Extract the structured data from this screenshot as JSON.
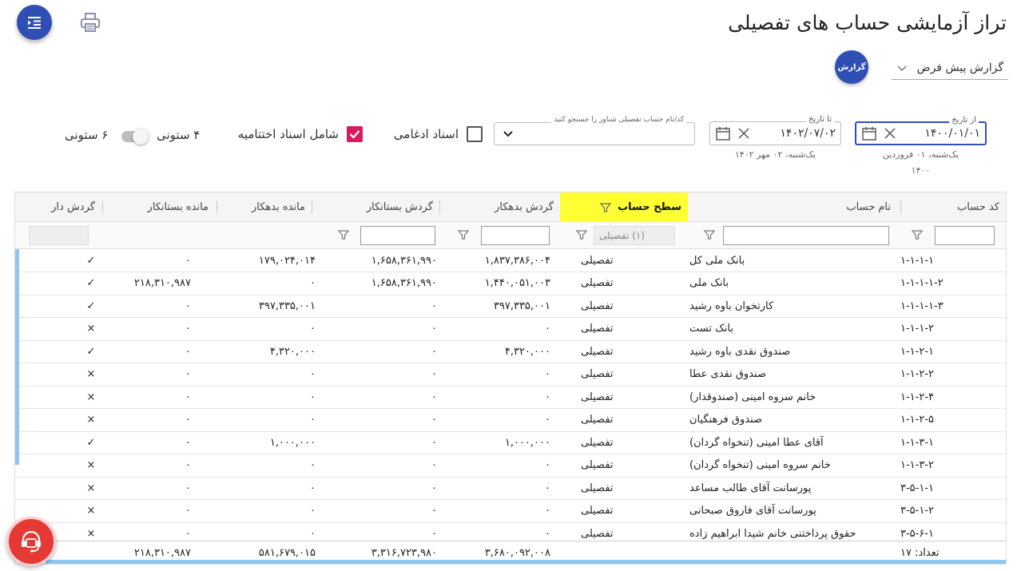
{
  "page": {
    "title": "تراز آزمایشی حساب های تفصیلی"
  },
  "toolbar": {
    "menu_icon": "menu-indent-icon",
    "print_icon": "printer-icon"
  },
  "report": {
    "selected": "گزارش پیش فرض",
    "button_label": "گزارش"
  },
  "filters": {
    "from_date": {
      "label": "از تاریخ",
      "value": "۱۴۰۰/۰۱/۰۱",
      "hint_line1": "یک‌شنبه، ۰۱ فروردین",
      "hint_line2": "۱۴۰۰"
    },
    "to_date": {
      "label": "تا تاریخ",
      "value": "۱۴۰۲/۰۷/۰۲",
      "hint": "یک‌شنبه، ۰۲ مهر ۱۴۰۲"
    },
    "search_label": "کد/نام حساب تفصیلی شناور را جستجو کنید",
    "merged_docs": {
      "label": "اسناد ادغامی",
      "checked": false
    },
    "closing_docs": {
      "label": "شامل اسناد اختتامیه",
      "checked": true
    },
    "cols4_label": "۴ ستونی",
    "cols6_label": "۶ ستونی"
  },
  "grid": {
    "headers": {
      "code": "کد حساب",
      "name": "نام حساب",
      "level": "سطح حساب",
      "debit_turnover": "گردش بدهکار",
      "credit_turnover": "گردش بستانکار",
      "debit_balance": "مانده بدهکار",
      "credit_balance": "مانده بستانکار",
      "has_turnover": "گردش دار"
    },
    "level_filter_value": "(۱) تفصیلی",
    "rows": [
      {
        "code": "۱-۱-۱-۱",
        "name": "بانک ملی کل",
        "level": "تفصیلی",
        "dt": "۱,۸۳۷,۳۸۶,۰۰۴",
        "ct": "۱,۶۵۸,۳۶۱,۹۹۰",
        "db": "۱۷۹,۰۲۴,۰۱۴",
        "cb": "۰",
        "flag": "✓"
      },
      {
        "code": "۱-۱-۱-۱-۲",
        "name": "بانک ملی",
        "level": "تفصیلی",
        "dt": "۱,۴۴۰,۰۵۱,۰۰۳",
        "ct": "۱,۶۵۸,۳۶۱,۹۹۰",
        "db": "۰",
        "cb": "۲۱۸,۳۱۰,۹۸۷",
        "flag": "✓"
      },
      {
        "code": "۱-۱-۱-۱-۳",
        "name": "کارتخوان باوه رشید",
        "level": "تفصیلی",
        "dt": "۳۹۷,۳۳۵,۰۰۱",
        "ct": "۰",
        "db": "۳۹۷,۳۳۵,۰۰۱",
        "cb": "۰",
        "flag": "✓"
      },
      {
        "code": "۱-۱-۱-۲",
        "name": "بانک تست",
        "level": "تفصیلی",
        "dt": "۰",
        "ct": "۰",
        "db": "۰",
        "cb": "۰",
        "flag": "×"
      },
      {
        "code": "۱-۱-۲-۱",
        "name": "صندوق نقدی باوه رشید",
        "level": "تفصیلی",
        "dt": "۴,۳۲۰,۰۰۰",
        "ct": "۰",
        "db": "۴,۳۲۰,۰۰۰",
        "cb": "۰",
        "flag": "✓"
      },
      {
        "code": "۱-۱-۲-۲",
        "name": "صندوق نقدی عطا",
        "level": "تفصیلی",
        "dt": "۰",
        "ct": "۰",
        "db": "۰",
        "cb": "۰",
        "flag": "×"
      },
      {
        "code": "۱-۱-۲-۴",
        "name": "خانم سروه امینی (صندوقدار)",
        "level": "تفصیلی",
        "dt": "۰",
        "ct": "۰",
        "db": "۰",
        "cb": "۰",
        "flag": "×"
      },
      {
        "code": "۱-۱-۲-۵",
        "name": "صندوق فرهنگیان",
        "level": "تفصیلی",
        "dt": "۰",
        "ct": "۰",
        "db": "۰",
        "cb": "۰",
        "flag": "×"
      },
      {
        "code": "۱-۱-۳-۱",
        "name": "آقای عطا امینی (تنخواه گردان)",
        "level": "تفصیلی",
        "dt": "۱,۰۰۰,۰۰۰",
        "ct": "۰",
        "db": "۱,۰۰۰,۰۰۰",
        "cb": "۰",
        "flag": "✓"
      },
      {
        "code": "۱-۱-۳-۲",
        "name": "خانم سروه امینی (تنخواه گردان)",
        "level": "تفصیلی",
        "dt": "۰",
        "ct": "۰",
        "db": "۰",
        "cb": "۰",
        "flag": "×"
      },
      {
        "code": "۳-۵-۱-۱",
        "name": "پورسانت آقای طالب مساعد",
        "level": "تفصیلی",
        "dt": "۰",
        "ct": "۰",
        "db": "۰",
        "cb": "۰",
        "flag": "×"
      },
      {
        "code": "۳-۵-۱-۲",
        "name": "پورسانت آقای فاروق صبحانی",
        "level": "تفصیلی",
        "dt": "۰",
        "ct": "۰",
        "db": "۰",
        "cb": "۰",
        "flag": "×"
      },
      {
        "code": "۳-۵-۶-۱",
        "name": "حقوق پرداختنی خانم شیدا ابراهیم زاده",
        "level": "تفصیلی",
        "dt": "۰",
        "ct": "۰",
        "db": "۰",
        "cb": "۰",
        "flag": "×"
      }
    ],
    "footer": {
      "count_label": "تعداد: ۱۷",
      "dt": "۳,۶۸۰,۰۹۲,۰۰۸",
      "ct": "۳,۳۱۶,۷۲۳,۹۸۰",
      "db": "۵۸۱,۶۷۹,۰۱۵",
      "cb": "۲۱۸,۳۱۰,۹۸۷"
    }
  },
  "support": {
    "icon": "headset-support-icon"
  },
  "colors": {
    "primary": "#2f4fb5",
    "highlight": "#ffff33",
    "check": "#d81b60",
    "support": "#e53935",
    "scroll": "#8fc7ef"
  }
}
